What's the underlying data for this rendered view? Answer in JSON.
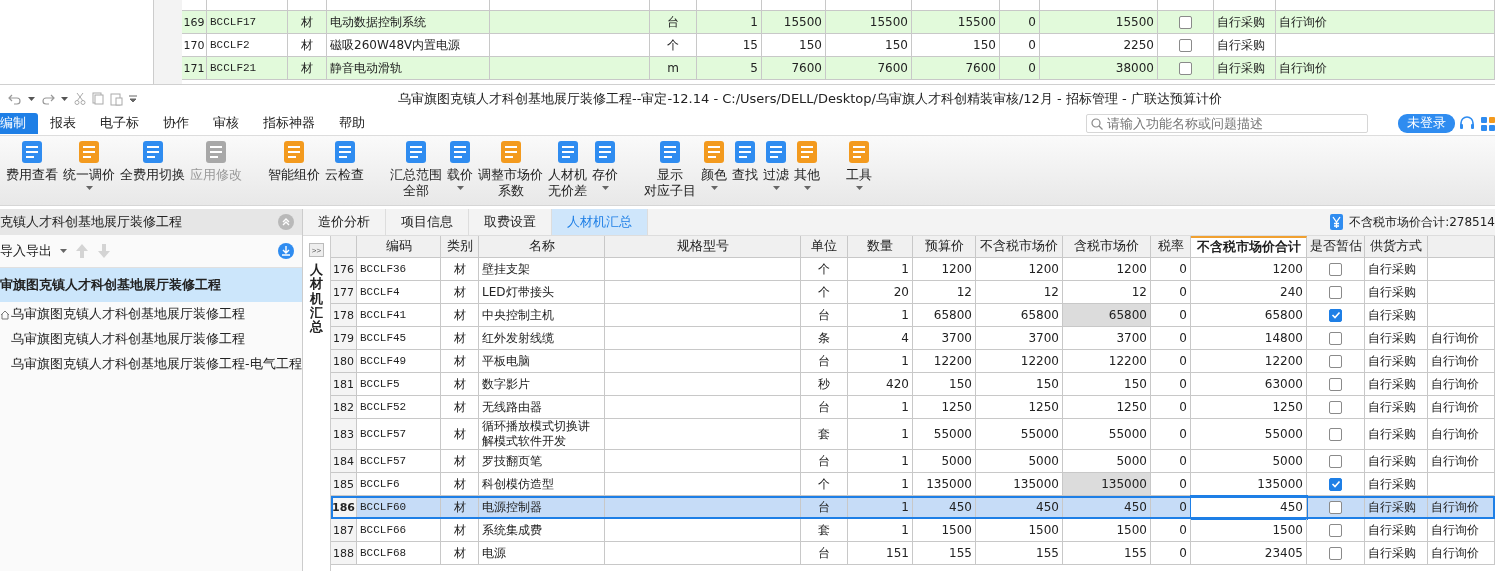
{
  "background_table": {
    "rows": [
      {
        "no": "169",
        "code": "BCCLF17",
        "type": "材",
        "name": "电动数据控制系统",
        "unit": "台",
        "qty": "1",
        "budget": "15500",
        "price_ex_tax": "15500",
        "price_inc_tax": "15500",
        "tax_rate": "0",
        "total": "15500",
        "provisional": false,
        "supply": "自行采购",
        "pricing": "自行询价",
        "highlighted": true
      },
      {
        "no": "170",
        "code": "BCCLF2",
        "type": "材",
        "name": "磁吸260W48V内置电源",
        "unit": "个",
        "qty": "15",
        "budget": "150",
        "price_ex_tax": "150",
        "price_inc_tax": "150",
        "tax_rate": "0",
        "total": "2250",
        "provisional": false,
        "supply": "自行采购",
        "highlighted": false
      },
      {
        "no": "171",
        "code": "BCCLF21",
        "type": "材",
        "name": "静音电动滑轨",
        "unit": "m",
        "qty": "5",
        "budget": "7600",
        "price_ex_tax": "7600",
        "price_inc_tax": "7600",
        "tax_rate": "0",
        "total": "38000",
        "provisional": false,
        "supply": "自行采购",
        "pricing": "自行询价",
        "highlighted": true
      }
    ]
  },
  "window": {
    "title": "乌审旗图克镇人才科创基地展厅装修工程--审定-12.14 - C:/Users/DELL/Desktop/乌审旗人才科创精装审核/12月 - 招标管理 - 广联达预算计价"
  },
  "menu": [
    {
      "label": "编制",
      "selected": true
    },
    {
      "label": "报表",
      "selected": false
    },
    {
      "label": "电子标",
      "selected": false
    },
    {
      "label": "协作",
      "selected": false
    },
    {
      "label": "审核",
      "selected": false
    },
    {
      "label": "指标神器",
      "selected": false
    },
    {
      "label": "帮助",
      "selected": false
    }
  ],
  "search": {
    "placeholder": "请输入功能名称或问题描述"
  },
  "login_button": "未登录",
  "toolbar_groups": [
    {
      "buttons": [
        {
          "lines": [
            "费用查看"
          ],
          "dropdown": false,
          "disabled": false
        },
        {
          "lines": [
            "统一调价"
          ],
          "dropdown": true,
          "disabled": false
        },
        {
          "lines": [
            "全费用切换"
          ],
          "dropdown": false,
          "disabled": false
        },
        {
          "lines": [
            "应用修改"
          ],
          "dropdown": false,
          "disabled": true
        }
      ]
    },
    {
      "buttons": [
        {
          "lines": [
            "智能组价"
          ],
          "dropdown": false,
          "disabled": false
        },
        {
          "lines": [
            "云检查"
          ],
          "dropdown": false,
          "disabled": false
        }
      ]
    },
    {
      "buttons": [
        {
          "lines": [
            "汇总范围",
            "全部"
          ],
          "dropdown": false,
          "disabled": false
        },
        {
          "lines": [
            "载价"
          ],
          "dropdown": true,
          "disabled": false
        },
        {
          "lines": [
            "调整市场价",
            "系数"
          ],
          "dropdown": false,
          "disabled": false
        },
        {
          "lines": [
            "人材机",
            "无价差"
          ],
          "dropdown": false,
          "disabled": false
        },
        {
          "lines": [
            "存价"
          ],
          "dropdown": true,
          "disabled": false
        }
      ]
    },
    {
      "buttons": [
        {
          "lines": [
            "显示",
            "对应子目"
          ],
          "dropdown": false,
          "disabled": false
        },
        {
          "lines": [
            "颜色"
          ],
          "dropdown": true,
          "disabled": false
        },
        {
          "lines": [
            "查找"
          ],
          "dropdown": false,
          "disabled": false
        },
        {
          "lines": [
            "过滤"
          ],
          "dropdown": true,
          "disabled": false
        },
        {
          "lines": [
            "其他"
          ],
          "dropdown": true,
          "disabled": false
        }
      ]
    },
    {
      "buttons": [
        {
          "lines": [
            "工具"
          ],
          "dropdown": true,
          "disabled": false
        }
      ]
    }
  ],
  "sidebar": {
    "title": "克镇人才科创基地展厅装修工程",
    "import_export": "导入导出",
    "tree": [
      {
        "label": "审旗图克镇人才科创基地展厅装修工程",
        "selected": true,
        "children": [
          {
            "label": "乌审旗图克镇人才科创基地展厅装修工程",
            "selected": false,
            "kind": "unit"
          },
          {
            "label": "乌审旗图克镇人才科创基地展厅装修工程",
            "selected": false,
            "kind": "sub"
          },
          {
            "label": "乌审旗图克镇人才科创基地展厅装修工程-电气工程",
            "selected": false,
            "kind": "sub"
          }
        ]
      }
    ]
  },
  "tabs": [
    {
      "label": "造价分析",
      "selected": false
    },
    {
      "label": "项目信息",
      "selected": false
    },
    {
      "label": "取费设置",
      "selected": false
    },
    {
      "label": "人材机汇总",
      "selected": true
    }
  ],
  "summary": "不含税市场价合计:278514",
  "side_strip": {
    "expand": ">>",
    "title": "人材机汇总"
  },
  "table": {
    "columns": [
      {
        "label": "编码",
        "highlighted": false
      },
      {
        "label": "类别",
        "highlighted": false
      },
      {
        "label": "名称",
        "highlighted": false
      },
      {
        "label": "规格型号",
        "highlighted": false
      },
      {
        "label": "单位",
        "highlighted": false
      },
      {
        "label": "数量",
        "highlighted": false
      },
      {
        "label": "预算价",
        "highlighted": false
      },
      {
        "label": "不含税市场价",
        "highlighted": false
      },
      {
        "label": "含税市场价",
        "highlighted": false
      },
      {
        "label": "税率",
        "highlighted": false
      },
      {
        "label": "不含税市场价合计",
        "highlighted": true
      },
      {
        "label": "是否暂估",
        "highlighted": false
      },
      {
        "label": "供货方式",
        "highlighted": false
      }
    ],
    "rows": [
      {
        "no": "176",
        "code": "BCCLF36",
        "type": "材",
        "name": "壁挂支架",
        "unit": "个",
        "qty": "1",
        "budget": "1200",
        "price_ex_tax": "1200",
        "price_inc_tax": "1200",
        "price_locked": false,
        "tax_rate": "0",
        "total": "1200",
        "provisional": false,
        "supply": "自行采购",
        "selected": false
      },
      {
        "no": "177",
        "code": "BCCLF4",
        "type": "材",
        "name": "LED灯带接头",
        "unit": "个",
        "qty": "20",
        "budget": "12",
        "price_ex_tax": "12",
        "price_inc_tax": "12",
        "price_locked": false,
        "tax_rate": "0",
        "total": "240",
        "provisional": false,
        "supply": "自行采购",
        "selected": false
      },
      {
        "no": "178",
        "code": "BCCLF41",
        "type": "材",
        "name": "中央控制主机",
        "unit": "台",
        "qty": "1",
        "budget": "65800",
        "price_ex_tax": "65800",
        "price_inc_tax": "65800",
        "price_locked": true,
        "tax_rate": "0",
        "total": "65800",
        "provisional": true,
        "supply": "自行采购",
        "selected": false
      },
      {
        "no": "179",
        "code": "BCCLF45",
        "type": "材",
        "name": "红外发射线缆",
        "unit": "条",
        "qty": "4",
        "budget": "3700",
        "price_ex_tax": "3700",
        "price_inc_tax": "3700",
        "price_locked": false,
        "tax_rate": "0",
        "total": "14800",
        "provisional": false,
        "supply": "自行采购",
        "pricing": "自行询价",
        "selected": false
      },
      {
        "no": "180",
        "code": "BCCLF49",
        "type": "材",
        "name": "平板电脑",
        "unit": "台",
        "qty": "1",
        "budget": "12200",
        "price_ex_tax": "12200",
        "price_inc_tax": "12200",
        "price_locked": false,
        "tax_rate": "0",
        "total": "12200",
        "provisional": false,
        "supply": "自行采购",
        "pricing": "自行询价",
        "selected": false
      },
      {
        "no": "181",
        "code": "BCCLF5",
        "type": "材",
        "name": "数字影片",
        "unit": "秒",
        "qty": "420",
        "budget": "150",
        "price_ex_tax": "150",
        "price_inc_tax": "150",
        "price_locked": false,
        "tax_rate": "0",
        "total": "63000",
        "provisional": false,
        "supply": "自行采购",
        "pricing": "自行询价",
        "selected": false
      },
      {
        "no": "182",
        "code": "BCCLF52",
        "type": "材",
        "name": "无线路由器",
        "unit": "台",
        "qty": "1",
        "budget": "1250",
        "price_ex_tax": "1250",
        "price_inc_tax": "1250",
        "price_locked": false,
        "tax_rate": "0",
        "total": "1250",
        "provisional": false,
        "supply": "自行采购",
        "pricing": "自行询价",
        "selected": false
      },
      {
        "no": "183",
        "code": "BCCLF57",
        "type": "材",
        "name": "循环播放模式切换讲解模式软件开发",
        "unit": "套",
        "qty": "1",
        "budget": "55000",
        "price_ex_tax": "55000",
        "price_inc_tax": "55000",
        "price_locked": false,
        "tax_rate": "0",
        "total": "55000",
        "provisional": false,
        "supply": "自行采购",
        "pricing": "自行询价",
        "selected": false
      },
      {
        "no": "184",
        "code": "BCCLF57",
        "type": "材",
        "name": "罗技翻页笔",
        "unit": "台",
        "qty": "1",
        "budget": "5000",
        "price_ex_tax": "5000",
        "price_inc_tax": "5000",
        "price_locked": false,
        "tax_rate": "0",
        "total": "5000",
        "provisional": false,
        "supply": "自行采购",
        "pricing": "自行询价",
        "selected": false
      },
      {
        "no": "185",
        "code": "BCCLF6",
        "type": "材",
        "name": "科创模仿造型",
        "unit": "个",
        "qty": "1",
        "budget": "135000",
        "price_ex_tax": "135000",
        "price_inc_tax": "135000",
        "price_locked": true,
        "tax_rate": "0",
        "total": "135000",
        "provisional": true,
        "supply": "自行采购",
        "selected": false
      },
      {
        "no": "186",
        "code": "BCCLF60",
        "type": "材",
        "name": "电源控制器",
        "unit": "台",
        "qty": "1",
        "budget": "450",
        "price_ex_tax": "450",
        "price_inc_tax": "450",
        "price_locked": false,
        "tax_rate": "0",
        "total": "450",
        "provisional": false,
        "supply": "自行采购",
        "pricing": "自行询价",
        "selected": true
      },
      {
        "no": "187",
        "code": "BCCLF66",
        "type": "材",
        "name": "系统集成费",
        "unit": "套",
        "qty": "1",
        "budget": "1500",
        "price_ex_tax": "1500",
        "price_inc_tax": "1500",
        "price_locked": false,
        "tax_rate": "0",
        "total": "1500",
        "provisional": false,
        "supply": "自行采购",
        "pricing": "自行询价",
        "selected": false
      },
      {
        "no": "188",
        "code": "BCCLF68",
        "type": "材",
        "name": "电源",
        "unit": "台",
        "qty": "151",
        "budget": "155",
        "price_ex_tax": "155",
        "price_inc_tax": "155",
        "price_locked": false,
        "tax_rate": "0",
        "total": "23405",
        "provisional": false,
        "supply": "自行采购",
        "pricing": "自行询价",
        "selected": false
      }
    ]
  }
}
